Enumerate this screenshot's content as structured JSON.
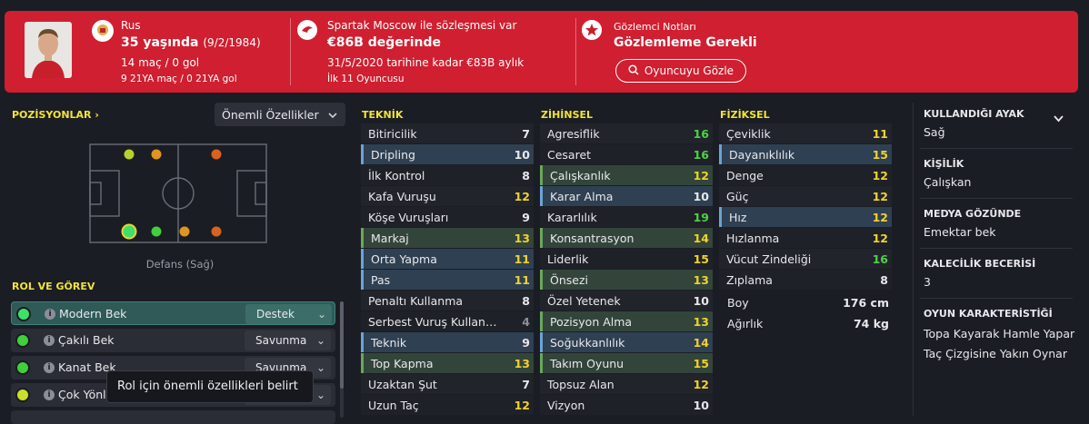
{
  "header": {
    "nationality": "Rus",
    "age": "35 yaşında",
    "birth": "(9/2/1984)",
    "apps": "14 maç / 0 gol",
    "u21": "9 21YA maç / 0 21YA gol",
    "contract_title": "Spartak Moscow ile sözleşmesi var",
    "value": "€86B değerinde",
    "wage": "31/5/2020 tarihine kadar €83B aylık",
    "squad_status": "İlk 11 Oyuncusu",
    "scout_title": "Gözlemci Notları",
    "scout_verdict": "Gözlemleme Gerekli",
    "scout_button": "Oyuncuyu Gözle"
  },
  "positions": {
    "title": "POZİSYONLAR",
    "dropdown": "Önemli Özellikler",
    "caption": "Defans (Sağ)"
  },
  "roles": {
    "title": "ROL VE GÖREV",
    "items": [
      {
        "label": "Modern Bek",
        "duty": "Destek",
        "color": "#3fe06a"
      },
      {
        "label": "Çakılı Bek",
        "duty": "Savunma",
        "color": "#3fd03a"
      },
      {
        "label": "Kanat Bek",
        "duty": "Savunma",
        "color": "#3fd03a"
      },
      {
        "label": "Çok Yönlü Bek",
        "duty": "",
        "color": "#c9e02a"
      }
    ],
    "tooltip": "Rol için önemli özellikleri belirt"
  },
  "technical": {
    "title": "TEKNİK",
    "items": [
      {
        "name": "Bitiricilik",
        "value": "7",
        "style": "plain",
        "vc": ""
      },
      {
        "name": "Dripling",
        "value": "10",
        "style": "blue",
        "vc": ""
      },
      {
        "name": "İlk Kontrol",
        "value": "8",
        "style": "alt",
        "vc": ""
      },
      {
        "name": "Kafa Vuruşu",
        "value": "12",
        "style": "plain",
        "vc": "y"
      },
      {
        "name": "Köşe Vuruşları",
        "value": "9",
        "style": "alt",
        "vc": ""
      },
      {
        "name": "Markaj",
        "value": "13",
        "style": "green",
        "vc": "y"
      },
      {
        "name": "Orta Yapma",
        "value": "11",
        "style": "blue",
        "vc": "y"
      },
      {
        "name": "Pas",
        "value": "11",
        "style": "blue",
        "vc": "y"
      },
      {
        "name": "Penaltı Kullanma",
        "value": "8",
        "style": "plain",
        "vc": ""
      },
      {
        "name": "Serbest Vuruş Kullan…",
        "value": "4",
        "style": "alt",
        "vc": "gr"
      },
      {
        "name": "Teknik",
        "value": "9",
        "style": "blue",
        "vc": ""
      },
      {
        "name": "Top Kapma",
        "value": "13",
        "style": "green",
        "vc": "y"
      },
      {
        "name": "Uzaktan Şut",
        "value": "7",
        "style": "plain",
        "vc": ""
      },
      {
        "name": "Uzun Taç",
        "value": "12",
        "style": "alt",
        "vc": "y"
      }
    ]
  },
  "mental": {
    "title": "ZİHİNSEL",
    "items": [
      {
        "name": "Agresiflik",
        "value": "16",
        "style": "plain",
        "vc": "g"
      },
      {
        "name": "Cesaret",
        "value": "16",
        "style": "alt",
        "vc": "g"
      },
      {
        "name": "Çalışkanlık",
        "value": "12",
        "style": "green",
        "vc": "y"
      },
      {
        "name": "Karar Alma",
        "value": "10",
        "style": "blue",
        "vc": ""
      },
      {
        "name": "Kararlılık",
        "value": "19",
        "style": "alt",
        "vc": "g"
      },
      {
        "name": "Konsantrasyon",
        "value": "14",
        "style": "green",
        "vc": "y"
      },
      {
        "name": "Liderlik",
        "value": "15",
        "style": "alt",
        "vc": "y"
      },
      {
        "name": "Önsezi",
        "value": "13",
        "style": "green",
        "vc": "y"
      },
      {
        "name": "Özel Yetenek",
        "value": "10",
        "style": "plain",
        "vc": ""
      },
      {
        "name": "Pozisyon Alma",
        "value": "13",
        "style": "green",
        "vc": "y"
      },
      {
        "name": "Soğukkanlılık",
        "value": "14",
        "style": "blue",
        "vc": "y"
      },
      {
        "name": "Takım Oyunu",
        "value": "15",
        "style": "green",
        "vc": "y"
      },
      {
        "name": "Topsuz Alan",
        "value": "12",
        "style": "plain",
        "vc": "y"
      },
      {
        "name": "Vizyon",
        "value": "10",
        "style": "alt",
        "vc": ""
      }
    ]
  },
  "physical": {
    "title": "FİZİKSEL",
    "items": [
      {
        "name": "Çeviklik",
        "value": "11",
        "style": "plain",
        "vc": "y"
      },
      {
        "name": "Dayanıklılık",
        "value": "15",
        "style": "blue",
        "vc": "y"
      },
      {
        "name": "Denge",
        "value": "12",
        "style": "alt",
        "vc": "y"
      },
      {
        "name": "Güç",
        "value": "12",
        "style": "plain",
        "vc": "y"
      },
      {
        "name": "Hız",
        "value": "12",
        "style": "blue",
        "vc": "y"
      },
      {
        "name": "Hızlanma",
        "value": "12",
        "style": "alt",
        "vc": "y"
      },
      {
        "name": "Vücut Zindeliği",
        "value": "16",
        "style": "plain",
        "vc": "g"
      },
      {
        "name": "Zıplama",
        "value": "8",
        "style": "alt",
        "vc": ""
      }
    ],
    "height_label": "Boy",
    "height": "176 cm",
    "weight_label": "Ağırlık",
    "weight": "74 kg"
  },
  "profile": {
    "foot_title": "KULLANDIĞI AYAK",
    "foot": "Sağ",
    "personality_title": "KİŞİLİK",
    "personality": "Çalışkan",
    "media_title": "MEDYA GÖZÜNDE",
    "media": "Emektar bek",
    "gk_title": "KALECİLİK BECERİSİ",
    "gk": "3",
    "traits_title": "OYUN KARAKTERİSTİĞİ",
    "trait1": "Topa Kayarak Hamle Yapar",
    "trait2": "Taç Çizgisine Yakın Oynar"
  },
  "pitch_positions": [
    {
      "name": "wingback-left-dot",
      "color": "#b8d22c"
    },
    {
      "name": "dm-left-dot",
      "color": "#e0951e"
    },
    {
      "name": "am-left-dot",
      "color": "#d8621e"
    },
    {
      "name": "fb-right-dot",
      "color": "#3fe06a"
    },
    {
      "name": "cb-right-dot",
      "color": "#3fd03a"
    },
    {
      "name": "dm-right-dot",
      "color": "#e0951e"
    },
    {
      "name": "am-right-dot",
      "color": "#d8621e"
    }
  ]
}
